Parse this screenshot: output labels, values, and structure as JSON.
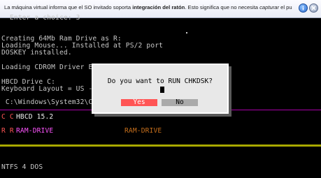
{
  "notice": {
    "text_pre": "La máquina virtual informa que el SO invitado soporta ",
    "text_bold": "integración del ratón",
    "text_mid": ". Esto significa que no necesita ",
    "text_italic": "capturar",
    "text_post": " el puntero del",
    "info_icon": "info-icon",
    "close_icon": "close-icon"
  },
  "terminal": {
    "lines": [
      "  Enter a choice: 3",
      "Creating 64Mb Ram Drive as R:",
      "Loading Mouse... Installed at PS/2 port",
      "DOSKEY installed.",
      "Loading CDROM Driver E0",
      "HBCD Drive C:",
      "Keyboard Layout = US -",
      " C:\\Windows\\System32\\Co"
    ],
    "drive_c_letters": "C C",
    "drive_c_label": "HBCD 15.2",
    "drive_r_letters": "R R",
    "drive_r_label": "RAM-DRIVE",
    "drive_r_label2": "RAM-DRIVE",
    "filesystem": "NTFS 4 DOS"
  },
  "dialog": {
    "question": "Do you want to RUN CHKDSK?",
    "yes_label": "Yes",
    "no_label": "No"
  },
  "colors": {
    "yes_button": "#ff5555",
    "no_button": "#aaaaaa",
    "dialog_bg": "#e8e8e8",
    "divider_yellow": "#a8a800",
    "text_magenta": "#ff55ff",
    "text_orange": "#c8701c"
  }
}
